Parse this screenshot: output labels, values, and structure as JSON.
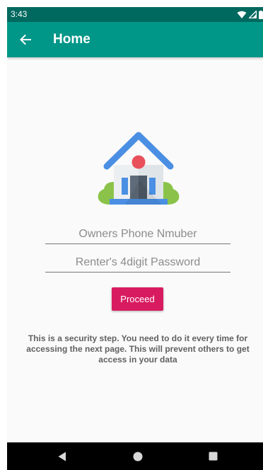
{
  "status_bar": {
    "time": "3:43",
    "icons": [
      "wifi-icon",
      "signal-icon",
      "battery-icon"
    ]
  },
  "app_bar": {
    "title": "Home",
    "back_icon": "arrow-left-icon"
  },
  "illustration": {
    "name": "house-icon"
  },
  "form": {
    "phone_placeholder": "Owners Phone Nmuber",
    "phone_value": "",
    "password_placeholder": "Renter's 4digit Password",
    "password_value": "",
    "proceed_label": "Proceed"
  },
  "note": "This is a security step. You need to do it every time for accessing the next page. This will prevent others to get access in your data",
  "nav_bar": {
    "icons": [
      "back-triangle-icon",
      "home-circle-icon",
      "recents-square-icon"
    ]
  },
  "colors": {
    "status_bar": "#00695f",
    "app_bar": "#009688",
    "accent": "#d81b60",
    "background": "#fafafa",
    "note_text": "#616161"
  }
}
